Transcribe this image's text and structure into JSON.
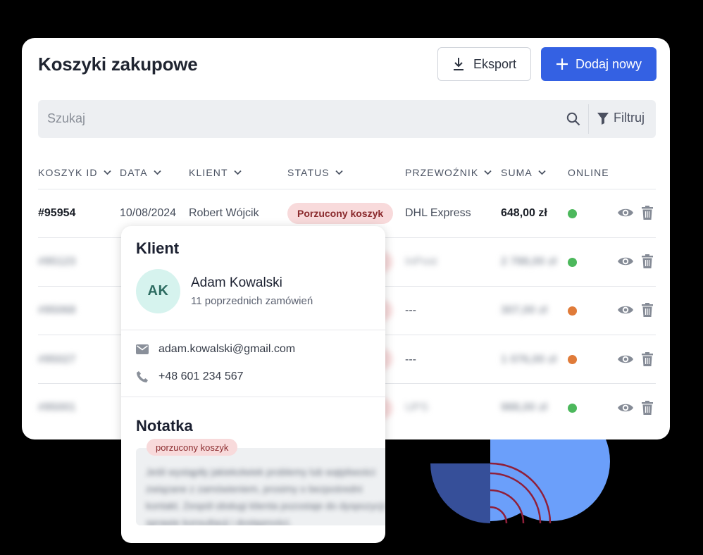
{
  "header": {
    "title": "Koszyki zakupowe",
    "export_label": "Eksport",
    "add_label": "Dodaj nowy"
  },
  "search": {
    "placeholder": "Szukaj",
    "filter_label": "Filtruj"
  },
  "table": {
    "columns": [
      "KOSZYK ID",
      "DATA",
      "KLIENT",
      "STATUS",
      "PRZEWOŹNIK",
      "SUMA",
      "ONLINE"
    ],
    "rows": [
      {
        "id": "#95954",
        "date": "10/08/2024",
        "client": "Robert Wójcik",
        "status": "Porzucony koszyk",
        "carrier": "DHL Express",
        "sum": "648,00 zł",
        "online_color": "#4cb85c"
      },
      {
        "id": "#95123",
        "date": "",
        "client": "",
        "status": "",
        "carrier": "InPost",
        "sum": "2 788,00 zł",
        "online_color": "#4cb85c"
      },
      {
        "id": "#95068",
        "date": "",
        "client": "",
        "status": "",
        "carrier": "---",
        "sum": "307,00 zł",
        "online_color": "#e07b39"
      },
      {
        "id": "#95027",
        "date": "",
        "client": "",
        "status": "",
        "carrier": "---",
        "sum": "1 076,00 zł",
        "online_color": "#e07b39"
      },
      {
        "id": "#95001",
        "date": "",
        "client": "",
        "status": "",
        "carrier": "UPS",
        "sum": "988,00 zł",
        "online_color": "#4cb85c"
      }
    ]
  },
  "popover": {
    "client_heading": "Klient",
    "avatar_initials": "AK",
    "customer_name": "Adam Kowalski",
    "orders_text": "11 poprzednich zamówień",
    "email": "adam.kowalski@gmail.com",
    "phone": "+48 601 234 567",
    "note_heading": "Notatka",
    "note_tag": "porzucony koszyk",
    "note_text": "Jeśli wystąpiły jakiekolwiek problemy lub wątpliwości związane z zamówieniem, prosimy o bezpośredni kontakt. Zespół obsługi klienta pozostaje do dyspozycji w sprawie konsultacji i dostępności."
  },
  "colors": {
    "accent": "#3461e3",
    "online_green": "#4cb85c",
    "online_orange": "#e07b39",
    "badge_bg": "#f8dadb",
    "badge_text": "#8a2a2d"
  }
}
